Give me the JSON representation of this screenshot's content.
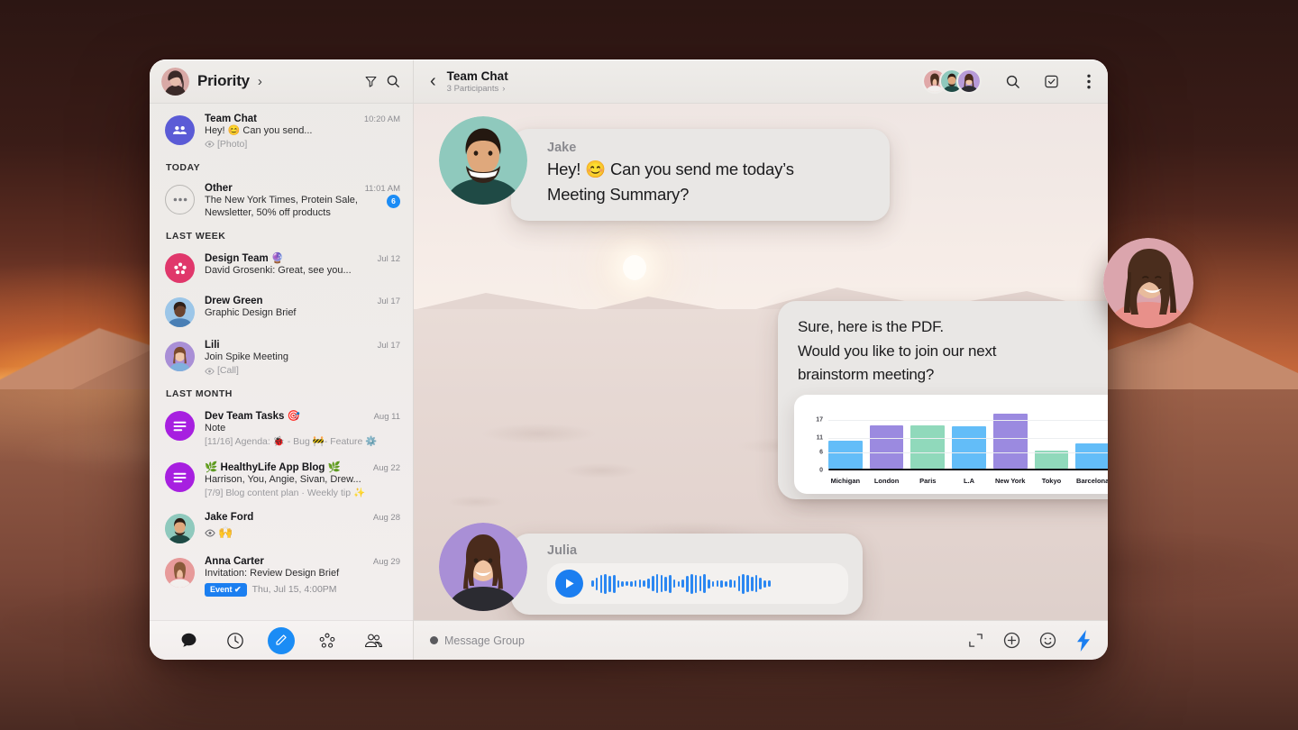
{
  "window": {
    "sidebar": {
      "header": {
        "title": "Priority",
        "chevron": "›",
        "filter_icon": "filter-icon",
        "search_icon": "search-icon"
      },
      "threads": [
        {
          "id": "team-chat",
          "name": "Team Chat",
          "time": "10:20 AM",
          "preview": "Hey! 😊 Can you send...",
          "meta": "[Photo]",
          "meta_icon": "eye-icon",
          "avatar_kind": "group-icon",
          "avatar_color": "#5b5bd6"
        },
        {
          "id": "other",
          "name": "Other",
          "time": "11:01 AM",
          "preview": "The New York Times, Protein Sale, Newsletter, 50% off products",
          "badge": "6",
          "avatar_kind": "ellipsis-icon",
          "avatar_color": "#ffffff"
        },
        {
          "id": "design-team",
          "name": "Design Team 🔮",
          "time": "Jul 12",
          "preview": "David Grosenki: Great, see you...",
          "avatar_kind": "dots-cluster-icon",
          "avatar_color": "#e0376b"
        },
        {
          "id": "drew-green",
          "name": "Drew Green",
          "time": "Jul 17",
          "preview": "Graphic Design Brief",
          "avatar_kind": "photo",
          "avatar_color": "#9cc6e8"
        },
        {
          "id": "lili",
          "name": "Lili",
          "time": "Jul 17",
          "preview": "Join Spike Meeting",
          "meta": "[Call]",
          "meta_icon": "eye-icon",
          "avatar_kind": "photo",
          "avatar_color": "#a98fd6"
        },
        {
          "id": "dev-team-tasks",
          "name": "Dev Team Tasks 🎯",
          "time": "Aug 11",
          "preview": "Note",
          "meta": "[11/16] Agenda:  🐞 - Bug 🚧- Feature ⚙️",
          "avatar_kind": "note-icon",
          "avatar_color": "#a71fe0"
        },
        {
          "id": "healthylife-app-blog",
          "name": "🌿 HealthyLife App Blog 🌿",
          "time": "Aug 22",
          "preview": "Harrison, You, Angie, Sivan, Drew...",
          "meta": "[7/9] Blog content plan · Weekly tip ✨",
          "avatar_kind": "note-icon",
          "avatar_color": "#a71fe0"
        },
        {
          "id": "jake-ford",
          "name": "Jake Ford",
          "time": "Aug 28",
          "preview": "🙌",
          "meta_icon": "eye-icon",
          "avatar_kind": "photo",
          "avatar_color": "#8fc9bd"
        },
        {
          "id": "anna-carter",
          "name": "Anna Carter",
          "time": "Aug 29",
          "preview": "Invitation: Review Design Brief",
          "event_chip": "Event ✔",
          "event_when": "Thu, Jul 15, 4:00PM",
          "avatar_kind": "photo",
          "avatar_color": "#e79a9a"
        }
      ],
      "section_labels": {
        "today": "TODAY",
        "last_week": "LAST WEEK",
        "last_month": "LAST MONTH"
      },
      "nav": [
        {
          "id": "chats",
          "icon": "chat-bubble-icon",
          "active": false
        },
        {
          "id": "recent",
          "icon": "clock-icon",
          "active": false
        },
        {
          "id": "compose",
          "icon": "pencil-icon",
          "active": true
        },
        {
          "id": "apps",
          "icon": "apps-grid-icon",
          "active": false
        },
        {
          "id": "contacts",
          "icon": "people-icon",
          "active": false
        }
      ]
    },
    "chat": {
      "header": {
        "back_icon": "chevron-left-icon",
        "title": "Team Chat",
        "subtitle": "3 Participants",
        "subtitle_chevron": "›",
        "search_icon": "search-icon",
        "inbox_check_icon": "inbox-check-icon",
        "more_icon": "more-vertical-icon",
        "participant_avatars": [
          "anna",
          "jake",
          "julia"
        ]
      },
      "messages": [
        {
          "id": "jake-msg",
          "sender": "Jake",
          "text_line1": "Hey! 😊 Can you send me today’s",
          "text_line2": "Meeting Summary?",
          "avatar_color": "#8fc9bd"
        },
        {
          "id": "pdf-msg",
          "text_line1": "Sure, here is the PDF.",
          "text_line2": "Would you like to join our next",
          "text_line3": "brainstorm meeting?",
          "seen_icon": "eye-icon",
          "seen_color": "#16b84e"
        },
        {
          "id": "julia-voice",
          "sender": "Julia",
          "play_icon": "play-icon",
          "waveform_color": "#2b87f2",
          "avatar_color": "#a98fd6"
        }
      ],
      "composer": {
        "placeholder": "Message Group",
        "expand_icon": "expand-icon",
        "plus_icon": "plus-circle-icon",
        "emoji_icon": "smiley-icon",
        "send_icon": "lightning-bolt-icon",
        "send_color": "#1b7ef0"
      }
    }
  },
  "chart_data": {
    "type": "bar",
    "title": "",
    "xlabel": "",
    "ylabel": "",
    "categories": [
      "Michigan",
      "London",
      "Paris",
      "L.A",
      "New York",
      "Tokyo",
      "Barcelona"
    ],
    "values": [
      9.7,
      15.0,
      15.0,
      14.9,
      19.2,
      6.2,
      8.8
    ],
    "colors": [
      "#63bdf8",
      "#9b8ae0",
      "#90d9bb",
      "#63bdf8",
      "#9b8ae0",
      "#90d9bb",
      "#63bdf8"
    ],
    "ytick_labels": [
      "0",
      "6",
      "11",
      "17"
    ],
    "ytick_values": [
      0,
      6,
      11,
      17
    ],
    "ylim": [
      0,
      21
    ],
    "grid": true,
    "legend": "none"
  }
}
